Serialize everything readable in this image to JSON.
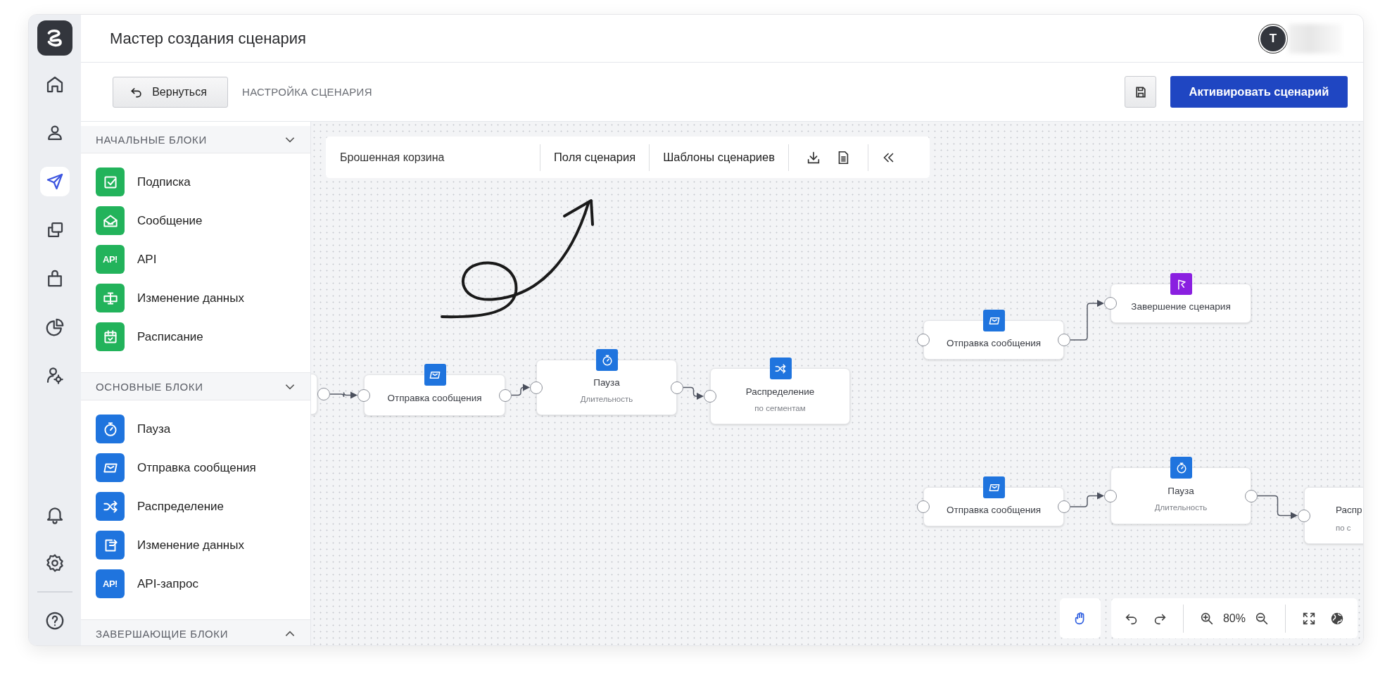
{
  "sidebar": {
    "nav_top": [
      {
        "kind": "home",
        "selected": false
      },
      {
        "kind": "user",
        "selected": false
      },
      {
        "kind": "send",
        "selected": true
      },
      {
        "kind": "copy",
        "selected": false
      },
      {
        "kind": "bag",
        "selected": false
      },
      {
        "kind": "pie",
        "selected": false
      },
      {
        "kind": "user-gear",
        "selected": false
      }
    ],
    "nav_bottom": [
      {
        "kind": "bell",
        "selected": false
      },
      {
        "kind": "gear",
        "selected": false
      },
      {
        "kind": "help",
        "selected": false
      }
    ]
  },
  "header": {
    "title": "Мастер создания сценария",
    "avatar": "T"
  },
  "toolbar": {
    "back_button": "Вернуться",
    "breadcrumb": "НАСТРОЙКА СЦЕНАРИЯ",
    "activate_button": "Активировать сценарий"
  },
  "block_sections": [
    {
      "title": "НАЧАЛЬНЫЕ БЛОКИ",
      "expanded": true,
      "color": "#22b35b",
      "items": [
        {
          "label": "Подписка",
          "kind": "subscribe"
        },
        {
          "label": "Сообщение",
          "kind": "envelope-open"
        },
        {
          "label": "API",
          "kind": "api",
          "icon_text": "AP!"
        },
        {
          "label": "Изменение данных",
          "kind": "monitor"
        },
        {
          "label": "Расписание",
          "kind": "calendar"
        }
      ]
    },
    {
      "title": "ОСНОВНЫЕ БЛОКИ",
      "expanded": true,
      "color": "#1f74de",
      "items": [
        {
          "label": "Пауза",
          "kind": "timer"
        },
        {
          "label": "Отправка сообщения",
          "kind": "message"
        },
        {
          "label": "Распределение",
          "kind": "shuffle"
        },
        {
          "label": "Изменение данных",
          "kind": "transfer"
        },
        {
          "label": "API-запрос",
          "kind": "api",
          "icon_text": "AP!"
        }
      ]
    },
    {
      "title": "ЗАВЕРШАЮЩИЕ БЛОКИ",
      "expanded": false
    }
  ],
  "canvas": {
    "toolbar": {
      "scenario_name": "Брошенная корзина",
      "tabs": [
        "Поля сценария",
        "Шаблоны сценариев"
      ]
    },
    "nodes": [
      {
        "kind": "partial"
      },
      {
        "title": "Отправка сообщения",
        "kind": "message",
        "color": "#1f74de"
      },
      {
        "title": "Пауза",
        "subtitle": "Длительность",
        "kind": "timer",
        "color": "#1f74de"
      },
      {
        "title": "Распределение",
        "subtitle": "по сегментам",
        "kind": "shuffle",
        "color": "#1f74de"
      },
      {
        "title": "Отправка сообщения",
        "kind": "message",
        "color": "#1f74de"
      },
      {
        "title": "Завершение сценария",
        "kind": "flag",
        "color": "#8a1fe0"
      },
      {
        "title": "Отправка сообщения",
        "kind": "message",
        "color": "#1f74de"
      },
      {
        "title": "Пауза",
        "subtitle": "Длительность",
        "kind": "timer",
        "color": "#1f74de"
      },
      {
        "title": "Распр",
        "subtitle": "по с",
        "kind": "partial"
      }
    ],
    "hand_tool": {
      "selected": true
    },
    "zoom": "80%"
  }
}
